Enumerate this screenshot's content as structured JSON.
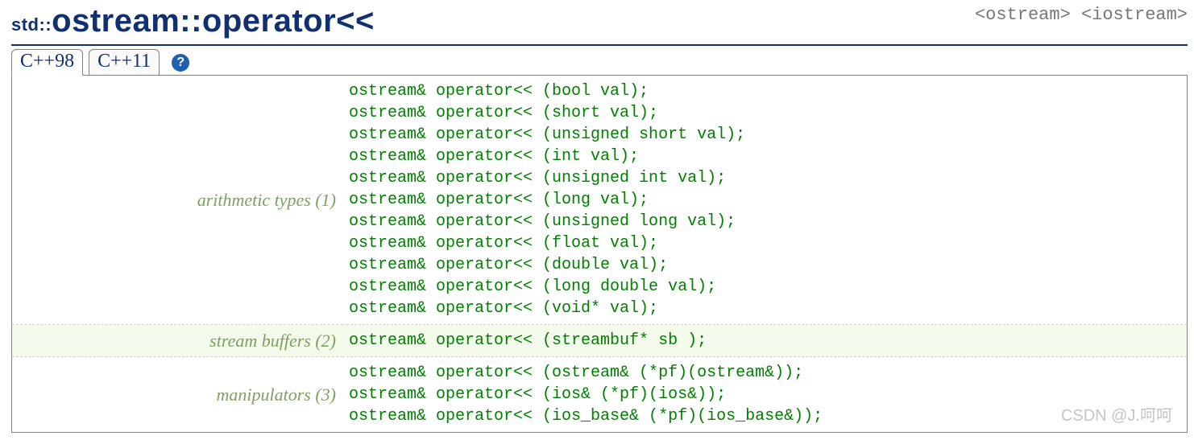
{
  "header": {
    "namespace": "std::",
    "title": "ostream::operator<<",
    "file_tags": "<ostream> <iostream>"
  },
  "tabs": {
    "items": [
      "C++98",
      "C++11"
    ],
    "active_index": 0
  },
  "sections": [
    {
      "label": "arithmetic types (1)",
      "shade": false,
      "code": "ostream& operator<< (bool val);\nostream& operator<< (short val);\nostream& operator<< (unsigned short val);\nostream& operator<< (int val);\nostream& operator<< (unsigned int val);\nostream& operator<< (long val);\nostream& operator<< (unsigned long val);\nostream& operator<< (float val);\nostream& operator<< (double val);\nostream& operator<< (long double val);\nostream& operator<< (void* val);"
    },
    {
      "label": "stream buffers (2)",
      "shade": true,
      "code": "ostream& operator<< (streambuf* sb );"
    },
    {
      "label": "manipulators (3)",
      "shade": false,
      "code": "ostream& operator<< (ostream& (*pf)(ostream&));\nostream& operator<< (ios& (*pf)(ios&));\nostream& operator<< (ios_base& (*pf)(ios_base&));"
    }
  ],
  "help_glyph": "?",
  "watermark": "CSDN @J.呵呵"
}
